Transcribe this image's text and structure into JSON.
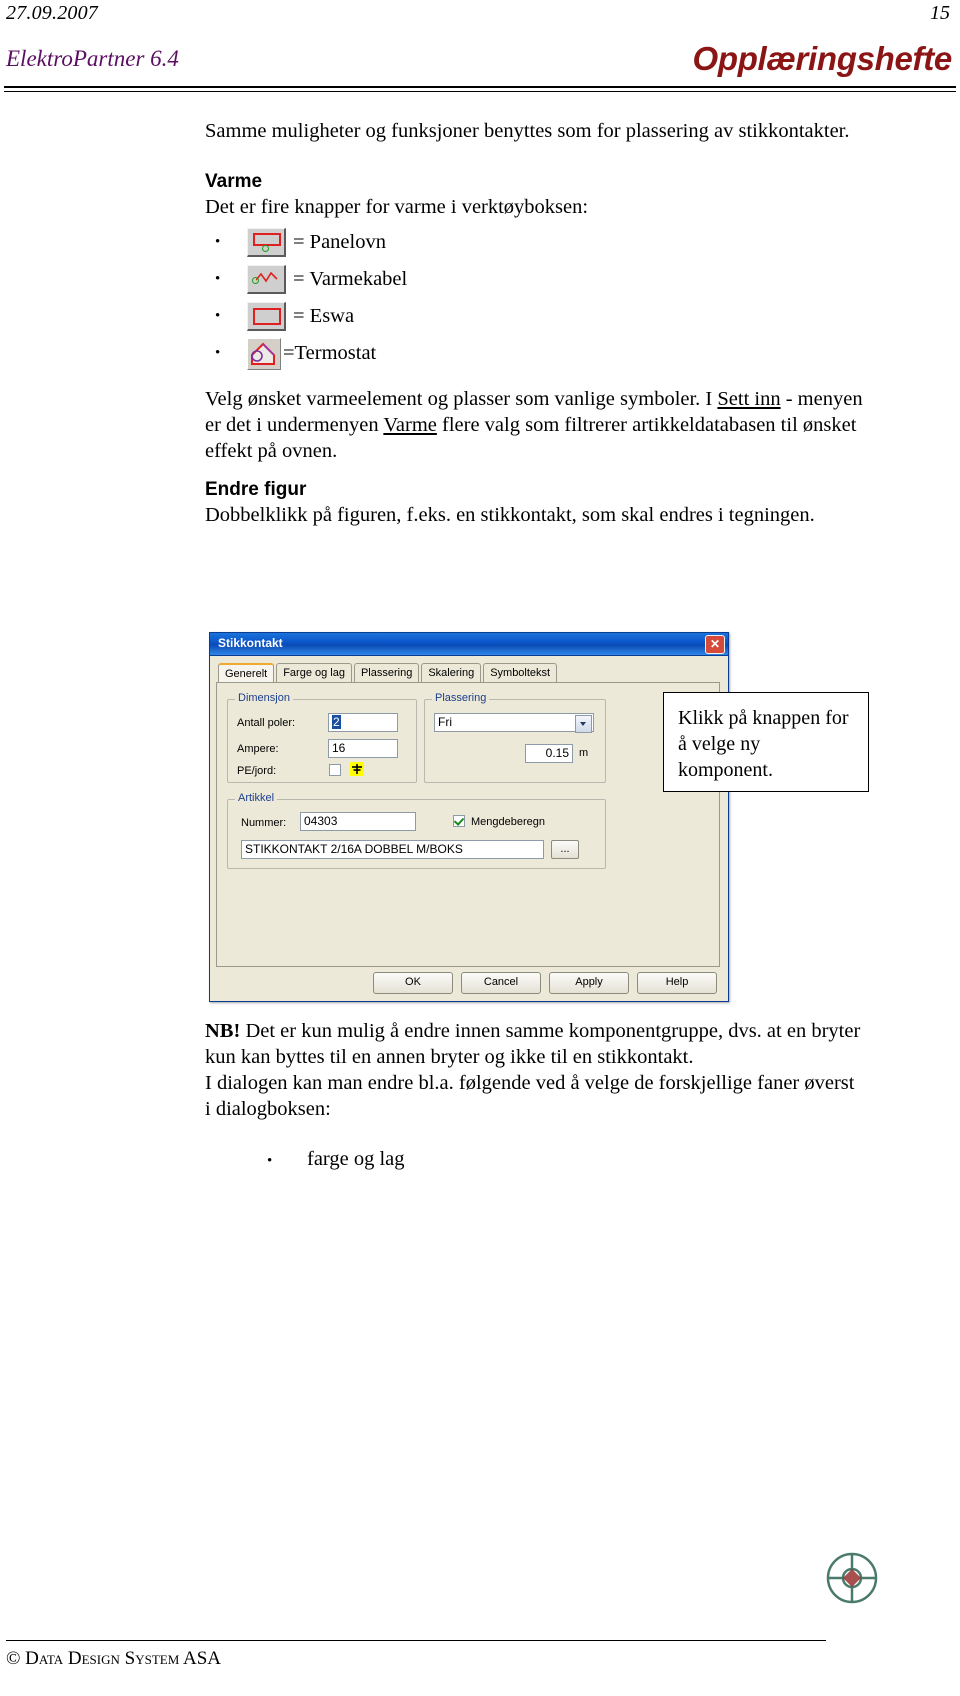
{
  "header": {
    "date": "27.09.2007",
    "page_number": "15",
    "brand": "ElektroPartner 6.4",
    "title": "Opplæringshefte"
  },
  "body": {
    "intro": "Samme muligheter og funksjoner benyttes som for plassering av stikkontakter.",
    "varme_heading": "Varme",
    "varme_lead": "Det er fire knapper for varme i verktøyboksen:",
    "icon_items": [
      {
        "bullet": "•",
        "icon": "panelovn-toolbar-icon",
        "label": "= Panelovn"
      },
      {
        "bullet": "•",
        "icon": "varmekabel-toolbar-icon",
        "label": "= Varmekabel"
      },
      {
        "bullet": "•",
        "icon": "eswa-toolbar-icon",
        "label": "= Eswa"
      },
      {
        "bullet": "•",
        "icon": "termostat-toolbar-icon",
        "label": "=Termostat"
      }
    ],
    "varme_p1_a": "Velg ønsket varmeelement og plasser som vanlige symboler. I ",
    "varme_p1_link1": "Sett inn",
    "varme_p1_b": " - menyen er det i undermenyen ",
    "varme_p1_link2": "Varme",
    "varme_p1_c": " flere valg som filtrerer artikkeldatabasen til ønsket effekt på ovnen.",
    "endre_heading": "Endre figur",
    "endre_text": "Dobbelklikk på figuren, f.eks. en stikkontakt, som skal endres i tegningen."
  },
  "callout": {
    "text": "Klikk på knappen for å velge ny komponent."
  },
  "dialog": {
    "title": "Stikkontakt",
    "close_label": "✕",
    "tabs": [
      {
        "label": "Generelt",
        "active": true
      },
      {
        "label": "Farge og lag",
        "active": false
      },
      {
        "label": "Plassering",
        "active": false
      },
      {
        "label": "Skalering",
        "active": false
      },
      {
        "label": "Symboltekst",
        "active": false
      }
    ],
    "dimensjon": {
      "group_label": "Dimensjon",
      "antall_poler_label": "Antall poler:",
      "antall_poler_value": "2",
      "ampere_label": "Ampere:",
      "ampere_value": "16",
      "pe_jord_label": "PE/jord:",
      "pe_jord_checked": false
    },
    "plassering": {
      "group_label": "Plassering",
      "mode_value": "Fri",
      "height_value": "0.15",
      "height_unit": "m"
    },
    "artikkel": {
      "group_label": "Artikkel",
      "nummer_label": "Nummer:",
      "nummer_value": "04303",
      "mengdeberegn_label": "Mengdeberegn",
      "mengdeberegn_checked": true,
      "description_value": "STIKKONTAKT 2/16A  DOBBEL M/BOKS",
      "browse_label": "..."
    },
    "buttons": [
      {
        "label": "OK"
      },
      {
        "label": "Cancel"
      },
      {
        "label": "Apply"
      },
      {
        "label": "Help"
      }
    ]
  },
  "notes": {
    "nb_label": "NB!",
    "nb_text": " Det er kun mulig å endre innen samme komponentgruppe, dvs. at en bryter kun kan byttes til en annen bryter og ikke til en stikkontakt.",
    "dialog_text": "I dialogen kan man endre bl.a. følgende ved å velge de forskjellige faner øverst i dialogboksen:",
    "list": [
      {
        "bullet": "•",
        "label": "farge og  lag"
      }
    ]
  },
  "footer": {
    "copyright": "© Data Design System ASA"
  },
  "colors": {
    "brand_purple": "#5b0f63",
    "title_red": "#8b1515",
    "dialog_blue": "#0a54c8",
    "tab_active": "#f0a830",
    "earth_yellow": "#ffff00",
    "icon_red": "#e02020",
    "icon_green": "#18a018"
  }
}
